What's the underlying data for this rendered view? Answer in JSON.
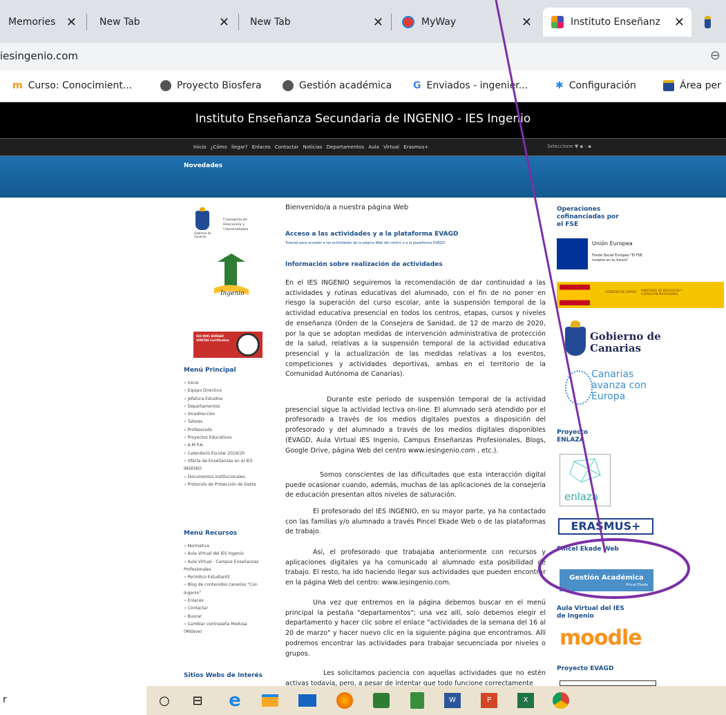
{
  "browser": {
    "tabs": [
      {
        "label": "Memories"
      },
      {
        "label": "New Tab"
      },
      {
        "label": "New Tab"
      },
      {
        "label": "MyWay"
      },
      {
        "label": "Instituto Enseñanz"
      }
    ],
    "address": "iesingenio.com",
    "bookmarks": [
      {
        "label": "Curso: Conocimient..."
      },
      {
        "label": "Proyecto Biosfera"
      },
      {
        "label": "Gestión académica"
      },
      {
        "label": "Enviados - ingenier..."
      },
      {
        "label": "Configuración"
      },
      {
        "label": "Área per"
      }
    ]
  },
  "site": {
    "title": "Instituto Enseñanza Secundaria de INGENIO - IES Ingenio",
    "nav": "Inicio   ¿Cómo llegar?   Enlaces   Contactar   Noticias   Departamentos   Aula Virtual   Erasmus+",
    "select_label": "Seleccione",
    "novedades": "Novedades",
    "logo_text": "Consejería de Educación y Universidades",
    "logo_sub": "Gobierno de Canarias",
    "iso_text": "ISO 9001 BUREAU VERITAS Certification",
    "ies_label": "Ingenio",
    "menu_principal_title": "Menú Principal",
    "menu_principal": [
      "Inicio",
      "Equipo Directivo",
      "Jefatura Estudios",
      "Departamentos",
      "Vicedirección",
      "Tutores",
      "Profesorado",
      "Proyectos Educativos",
      "A.M.P.A.",
      "Calendario Escolar 2019/20",
      "Oferta de Enseñanzas en el IES",
      "INGENIO",
      "Documentos Institucionales",
      "Protocolo de Protección de Datos"
    ],
    "menu_recursos_title": "Menú Recursos",
    "menu_recursos": [
      "Normativa",
      "Aula Virtual del IES Ingenio",
      "Aula Virtual - Campus Enseñanzas",
      "Profesionales",
      "Periódico Estudiantil",
      "Blog de contenidos canarios \"Con",
      "Ingenio\"",
      "Enlaces",
      "Contactar",
      "Buscar",
      "Cambiar contraseña Medusa",
      "(Midave)"
    ],
    "sitios_title": "Sitios Webs de Interés",
    "welcome": "Bienvenido/a a nuestra página Web",
    "link_title": "Acceso a las actividades y a la plataforma EVAGD",
    "link_sub": "Tutorial para acceder a las actividades de la página Web del centro y a la plataforma EVAGD",
    "info_title": "Información sobre realización de actividades",
    "paragraphs": [
      "En el IES INGENIO seguiremos la recomendación de dar continuidad a las actividades y rutinas educativas del alumnado, con el fin de no poner en riesgo la superación del curso escolar, ante la suspensión temporal de la actividad educativa presencial en todos los centros, etapas, cursos y niveles de enseñanza (Orden de la Consejera de Sanidad, de 12 de marzo de 2020, por la que se adoptan medidas de intervención administrativa de protección de la salud, relativas a la suspensión temporal de la actividad educativa presencial y la actualización de las medidas relativas a los eventos, competiciones y actividades deportivas, ambas en el territorio de la Comunidad Autónoma de Canarias).",
      "Durante este periodo de suspensión temporal de la actividad presencial sigue la actividad lectiva on-line. El alumnado será atendido por el profesorado a través de los medios digitales puestos a disposición del profesorado y del alumnado a través de los medios digitales disponibles (EVAGD, Aula Virtual IES Ingenio, Campus Enseñanzas Profesionales, Blogs, Google Drive, página Web del centro www.iesingenio.com , etc.).",
      "Somos conscientes de las dificultades que esta interacción digital puede ocasionar cuando, además, muchas de las aplicaciones de la consejería de educación presentan altos niveles de saturación.",
      "El profesorado del IES INGENIO, en su mayor parte, ya ha contactado con las familias y/o alumnado a través Pincel Ekade Web o de las plataformas de trabajo.",
      "Así, el profesorado que trabajaba anteriormente con recursos y aplicaciones digitales ya ha comunicado al alumnado esta posibilidad de trabajo. El resto, ha ido haciendo llegar sus actividades que pueden encontrar en la página Web del centro: www.iesingenio.com.",
      "Una vez que entremos en la página debemos buscar en el menú principal la pestaña \"departamentos\"; una vez allí, solo debemos elegir el departamento y hacer clic sobre el enlace \"actividades de la semana del 16 al 20 de marzo\" y hacer nuevo clic en la siguiente página que encontramos. Allí podremos encontrar las actividades para trabajar secuenciada por niveles o grupos.",
      "Les solicitamos paciencia con aquellas actividades que no estén activas todavía, pero, a pesar de intentar que todo funcione correctamente"
    ],
    "right": {
      "operaciones": "Operaciones cofinanciadas por el FSE",
      "eu_title": "Unión Europea",
      "eu_sub": "Fondo Social Europeo \"El FSE invierte en tu futuro\"",
      "gob_min": "GOBIERNO DE ESPAÑA",
      "gob_min2": "MINISTERIO DE EDUCACIÓN Y FORMACIÓN PROFESIONAL",
      "gobierno": "Gobierno de Canarias",
      "canarias": "Canarias avanza con Europa",
      "enlaza_title": "Proyecto ENLAZA",
      "enlaza": "enlaza",
      "erasmus": "ERASMUS+",
      "pincel": "Pincel Ekade Web",
      "gestion": "Gestión Académica",
      "gestion_sub": "Pincel Ekade",
      "aula": "Aula Virtual del IES de Ingenio",
      "moodle": "moodle",
      "evagd": "Proyecto EVAGD"
    }
  },
  "taskbar": {
    "search_text": "r"
  },
  "colors": {
    "accent": "#1a4e8a",
    "annotation": "#7b2fa6",
    "header": "#000000",
    "nav_blue": "#1a73b8"
  }
}
